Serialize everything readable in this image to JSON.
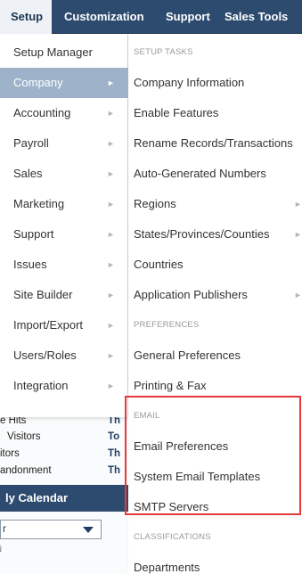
{
  "topnav": {
    "tabs": [
      {
        "label": "Setup"
      },
      {
        "label": "Customization"
      },
      {
        "label": "Support"
      },
      {
        "label": "Sales Tools"
      }
    ]
  },
  "menu1": {
    "items": [
      {
        "label": "Setup Manager",
        "has_submenu": false
      },
      {
        "label": "Company",
        "has_submenu": true,
        "active": true
      },
      {
        "label": "Accounting",
        "has_submenu": true
      },
      {
        "label": "Payroll",
        "has_submenu": true
      },
      {
        "label": "Sales",
        "has_submenu": true
      },
      {
        "label": "Marketing",
        "has_submenu": true
      },
      {
        "label": "Support",
        "has_submenu": true
      },
      {
        "label": "Issues",
        "has_submenu": true
      },
      {
        "label": "Site Builder",
        "has_submenu": true
      },
      {
        "label": "Import/Export",
        "has_submenu": true
      },
      {
        "label": "Users/Roles",
        "has_submenu": true
      },
      {
        "label": "Integration",
        "has_submenu": true
      }
    ]
  },
  "menu2": {
    "setup_tasks_header": "SETUP TASKS",
    "setup_tasks": [
      {
        "label": "Company Information"
      },
      {
        "label": "Enable Features"
      },
      {
        "label": "Rename Records/Transactions"
      },
      {
        "label": "Auto-Generated Numbers"
      },
      {
        "label": "Regions"
      },
      {
        "label": "States/Provinces/Counties"
      },
      {
        "label": "Countries"
      },
      {
        "label": "Application Publishers"
      }
    ],
    "preferences_header": "PREFERENCES",
    "preferences": [
      {
        "label": "General Preferences"
      },
      {
        "label": "Printing & Fax"
      }
    ],
    "email_header": "EMAIL",
    "email": [
      {
        "label": "Email Preferences"
      },
      {
        "label": "System Email Templates"
      },
      {
        "label": "SMTP Servers"
      }
    ],
    "classifications_header": "CLASSIFICATIONS",
    "classifications": [
      {
        "label": "Departments"
      }
    ]
  },
  "background": {
    "rows": [
      {
        "left": "e Hits",
        "right": "Th"
      },
      {
        "left": "Visitors",
        "right": "To"
      },
      {
        "left": "itors",
        "right": "Th"
      },
      {
        "left": "andonment",
        "right": "Th"
      }
    ],
    "calendar_title": "ly Calendar",
    "calendar_select_value": "r",
    "bottom_text": "ʲ"
  },
  "colors": {
    "nav_bg": "#2d4b6f",
    "active_item_bg": "#9eb3c9",
    "highlight_border": "#e5393a"
  }
}
